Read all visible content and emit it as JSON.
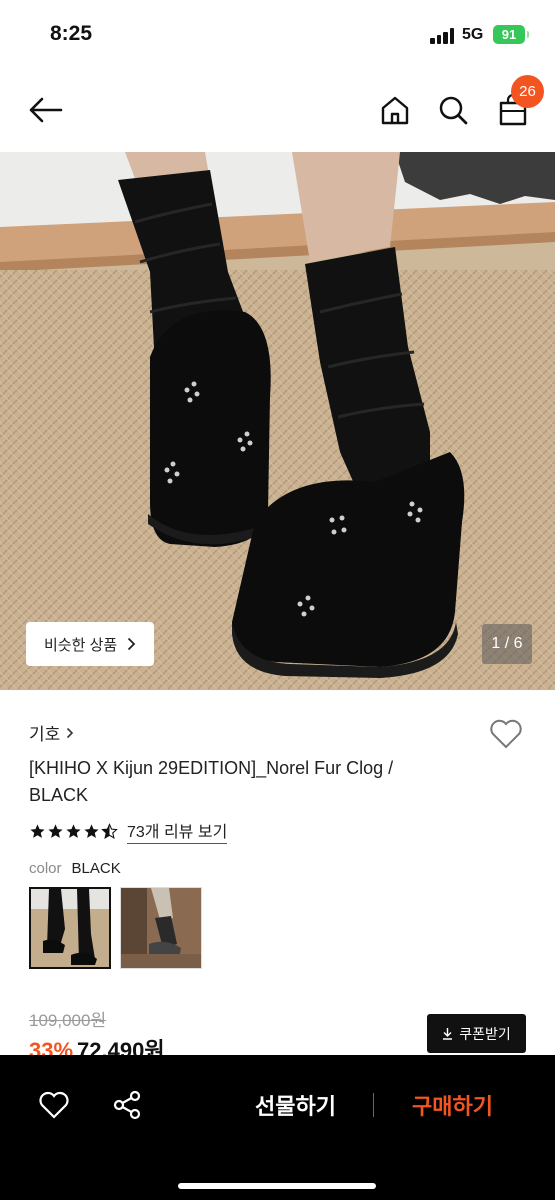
{
  "status_bar": {
    "time": "8:25",
    "network": "5G",
    "battery": "91"
  },
  "nav": {
    "cart_count": "26"
  },
  "gallery": {
    "similar_label": "비슷한 상품",
    "page_indicator": "1 / 6"
  },
  "product": {
    "brand": "기호",
    "name": "[KHIHO X Kijun 29EDITION]_Norel Fur Clog / BLACK",
    "rating": 4.5,
    "review_link": "73개 리뷰 보기",
    "color_label": "color",
    "color_value": "BLACK"
  },
  "price": {
    "original": "109,000원",
    "discount": "33%",
    "sale": "72,490원",
    "coupon_label": "쿠폰받기"
  },
  "bottom_bar": {
    "gift_label": "선물하기",
    "buy_label": "구매하기"
  },
  "colors": {
    "accent": "#f2551f",
    "battery": "#35c759"
  }
}
